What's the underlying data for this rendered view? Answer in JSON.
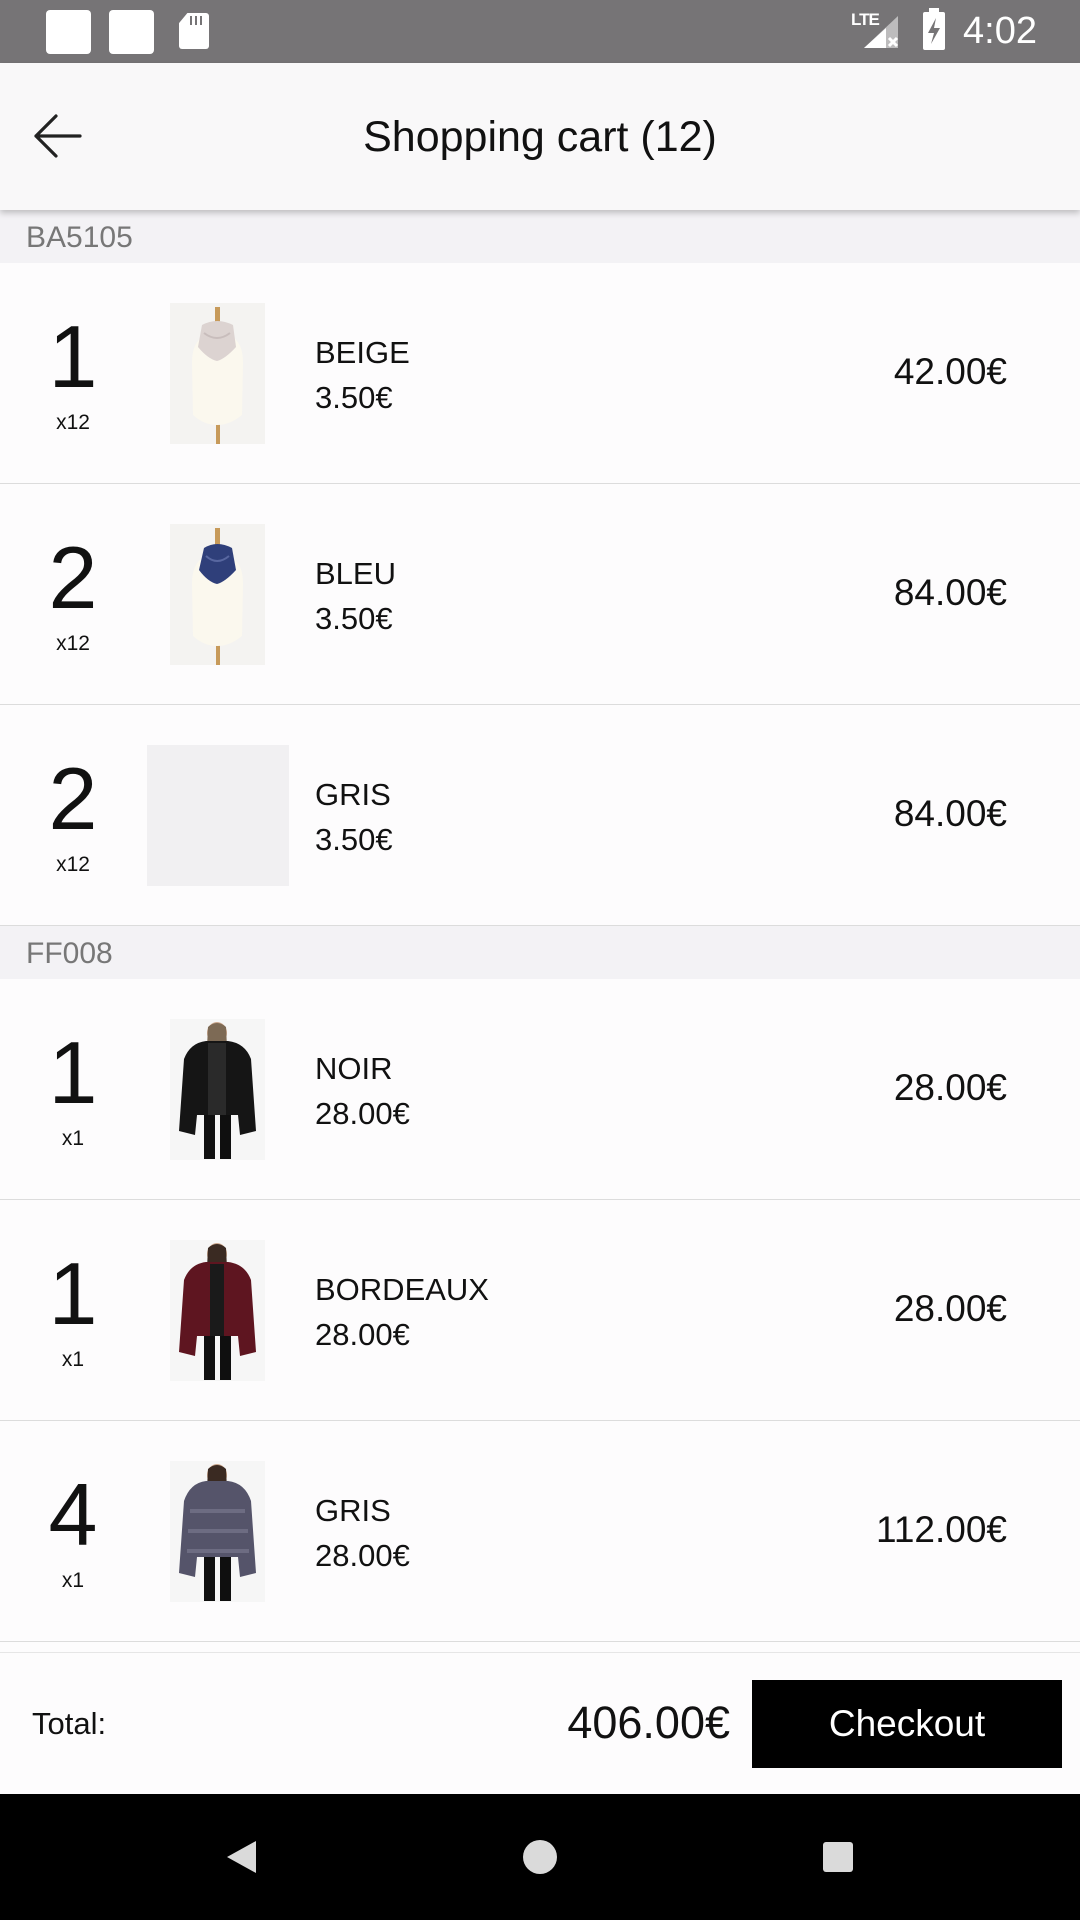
{
  "status_bar": {
    "network": "LTE",
    "time": "4:02"
  },
  "header": {
    "title": "Shopping cart (12)",
    "back_icon": "arrow-left-icon"
  },
  "groups": [
    {
      "reference": "BA5105",
      "items": [
        {
          "quantity": "1",
          "pack": "x12",
          "color": "BEIGE",
          "unit_price": "3.50€",
          "total": "42.00€",
          "image": "beige-scarf"
        },
        {
          "quantity": "2",
          "pack": "x12",
          "color": "BLEU",
          "unit_price": "3.50€",
          "total": "84.00€",
          "image": "blue-scarf"
        },
        {
          "quantity": "2",
          "pack": "x12",
          "color": "GRIS",
          "unit_price": "3.50€",
          "total": "84.00€",
          "image": "placeholder"
        }
      ]
    },
    {
      "reference": "FF008",
      "items": [
        {
          "quantity": "1",
          "pack": "x1",
          "color": "NOIR",
          "unit_price": "28.00€",
          "total": "28.00€",
          "image": "black-fur-coat"
        },
        {
          "quantity": "1",
          "pack": "x1",
          "color": "BORDEAUX",
          "unit_price": "28.00€",
          "total": "28.00€",
          "image": "bordeaux-fur-coat"
        },
        {
          "quantity": "4",
          "pack": "x1",
          "color": "GRIS",
          "unit_price": "28.00€",
          "total": "112.00€",
          "image": "grey-fur-coat"
        }
      ]
    }
  ],
  "footer": {
    "total_label": "Total:",
    "total_value": "406.00€",
    "checkout_label": "Checkout"
  },
  "colors": {
    "status_bar": "#767476",
    "app_bar": "#f9f8f9",
    "group_header": "#f3f2f5",
    "checkout": "#000000"
  }
}
